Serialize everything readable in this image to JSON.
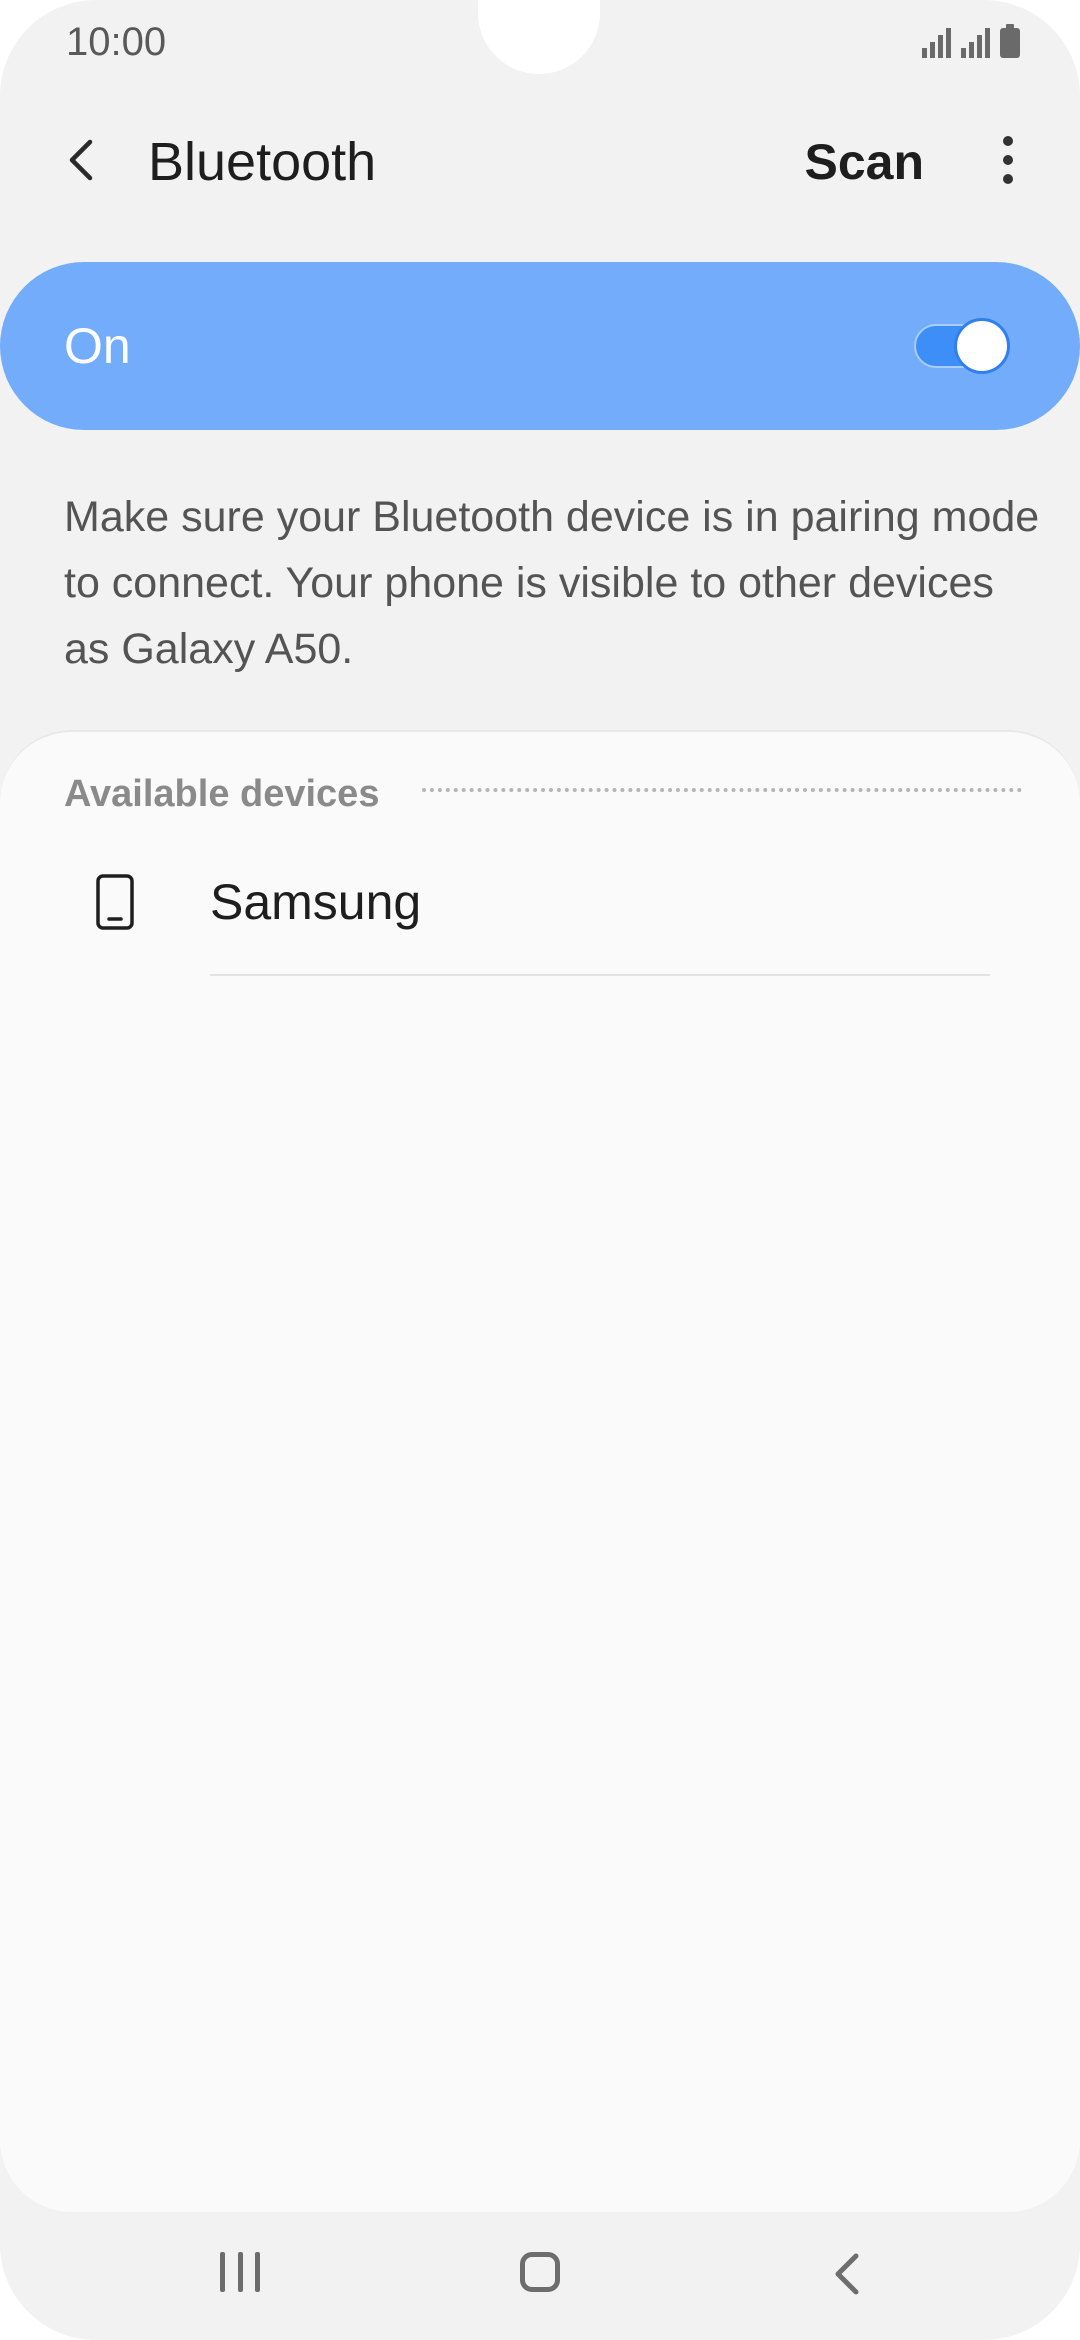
{
  "status_bar": {
    "time": "10:00",
    "icons": [
      "signal-sim1-icon",
      "signal-sim2-icon",
      "battery-icon"
    ]
  },
  "app_bar": {
    "title": "Bluetooth",
    "back_icon": "chevron-left-icon",
    "scan_label": "Scan",
    "more_icon": "more-vertical-icon"
  },
  "master_switch": {
    "label": "On",
    "state": true,
    "background_color": "#73acfb",
    "toggle_color": "#3e8ef7"
  },
  "description": "Make sure your Bluetooth device is in pairing mode to connect. Your phone is visible to other devices as Galaxy A50.",
  "devices": {
    "section_title": "Available devices",
    "items": [
      {
        "name": "Samsung",
        "icon": "phone-icon"
      }
    ]
  },
  "nav_bar": {
    "recents_icon": "recents-icon",
    "home_icon": "home-icon",
    "back_icon": "back-icon"
  }
}
